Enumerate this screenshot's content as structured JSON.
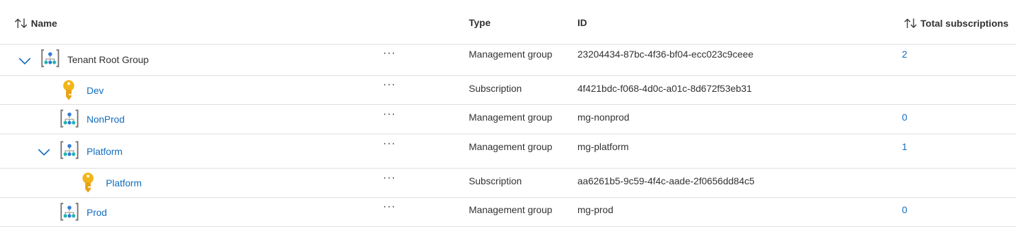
{
  "headers": {
    "name": "Name",
    "type": "Type",
    "id": "ID",
    "total_subscriptions": "Total subscriptions"
  },
  "rows": [
    {
      "name": "Tenant Root Group",
      "kind": "management-group",
      "type": "Management group",
      "id": "23204434-87bc-4f36-bf04-ecc023c9ceee",
      "count": "2",
      "expanded": true,
      "actions": "···"
    },
    {
      "name": "Dev",
      "kind": "subscription",
      "type": "Subscription",
      "id": "4f421bdc-f068-4d0c-a01c-8d672f53eb31",
      "count": "",
      "actions": "···"
    },
    {
      "name": "NonProd",
      "kind": "management-group",
      "type": "Management group",
      "id": "mg-nonprod",
      "count": "0",
      "actions": "···"
    },
    {
      "name": "Platform",
      "kind": "management-group",
      "type": "Management group",
      "id": "mg-platform",
      "count": "1",
      "expanded": true,
      "actions": "···"
    },
    {
      "name": "Platform",
      "kind": "subscription",
      "type": "Subscription",
      "id": "aa6261b5-9c59-4f4c-aade-2f0656dd84c5",
      "count": "",
      "actions": "···"
    },
    {
      "name": "Prod",
      "kind": "management-group",
      "type": "Management group",
      "id": "mg-prod",
      "count": "0",
      "actions": "···"
    }
  ],
  "colors": {
    "link": "#0f6cbd",
    "border": "#e1dfdd",
    "text": "#323130",
    "key_gold": "#f2b51a",
    "mg_blue": "#2f7ad8",
    "mg_teal": "#22b6b0"
  },
  "icons": {
    "sort": "sort-arrows-icon",
    "chevron": "chevron-down-icon",
    "management_group": "management-group-icon",
    "subscription": "subscription-key-icon",
    "more": "more-actions-icon"
  }
}
